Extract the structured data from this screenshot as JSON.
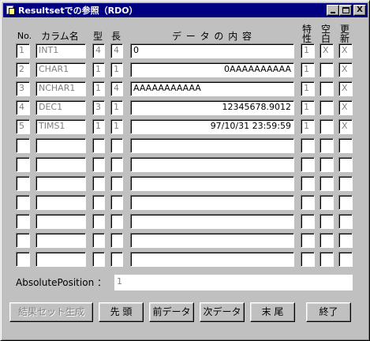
{
  "window": {
    "title": "Resultsetでの参照（RDO）",
    "buttons": {
      "minimize": "_",
      "maximize": "□",
      "close": "X"
    }
  },
  "headers": {
    "no": "No.",
    "column_name": "カラム名",
    "type": "型",
    "length": "長",
    "data_content": "デ ー タ の 内 容",
    "attribute": "特性",
    "blank": "空白",
    "update": "更新"
  },
  "rows": [
    {
      "no": "1",
      "name": "INT1",
      "type": "4",
      "length": "4",
      "data": "0",
      "data_align": "left",
      "attr": "1",
      "blank": "X",
      "update": "X"
    },
    {
      "no": "2",
      "name": "CHAR1",
      "type": "1",
      "length": "1",
      "data": "0AAAAAAAAAA",
      "data_align": "right",
      "attr": "1",
      "blank": "",
      "update": "X"
    },
    {
      "no": "3",
      "name": "NCHAR1",
      "type": "1",
      "length": "4",
      "data": "AAAAAAAAAAA",
      "data_align": "left",
      "attr": "1",
      "blank": "",
      "update": "X"
    },
    {
      "no": "4",
      "name": "DEC1",
      "type": "3",
      "length": "1",
      "data": "12345678.9012",
      "data_align": "right",
      "attr": "1",
      "blank": "",
      "update": "X"
    },
    {
      "no": "5",
      "name": "TIMS1",
      "type": "1",
      "length": "1",
      "data": "97/10/31 23:59:59",
      "data_align": "right",
      "attr": "1",
      "blank": "",
      "update": "X"
    },
    {
      "no": "",
      "name": "",
      "type": "",
      "length": "",
      "data": "",
      "data_align": "left",
      "attr": "",
      "blank": "",
      "update": ""
    },
    {
      "no": "",
      "name": "",
      "type": "",
      "length": "",
      "data": "",
      "data_align": "left",
      "attr": "",
      "blank": "",
      "update": ""
    },
    {
      "no": "",
      "name": "",
      "type": "",
      "length": "",
      "data": "",
      "data_align": "left",
      "attr": "",
      "blank": "",
      "update": ""
    },
    {
      "no": "",
      "name": "",
      "type": "",
      "length": "",
      "data": "",
      "data_align": "left",
      "attr": "",
      "blank": "",
      "update": ""
    },
    {
      "no": "",
      "name": "",
      "type": "",
      "length": "",
      "data": "",
      "data_align": "left",
      "attr": "",
      "blank": "",
      "update": ""
    },
    {
      "no": "",
      "name": "",
      "type": "",
      "length": "",
      "data": "",
      "data_align": "left",
      "attr": "",
      "blank": "",
      "update": ""
    },
    {
      "no": "",
      "name": "",
      "type": "",
      "length": "",
      "data": "",
      "data_align": "left",
      "attr": "",
      "blank": "",
      "update": ""
    }
  ],
  "absolute_position": {
    "label": "AbsolutePosition ：",
    "value": "1"
  },
  "buttons": {
    "create_resultset": "結果セット生成",
    "first": "先 頭",
    "previous": "前データ",
    "next": "次データ",
    "last": "末 尾",
    "exit": "終了"
  }
}
